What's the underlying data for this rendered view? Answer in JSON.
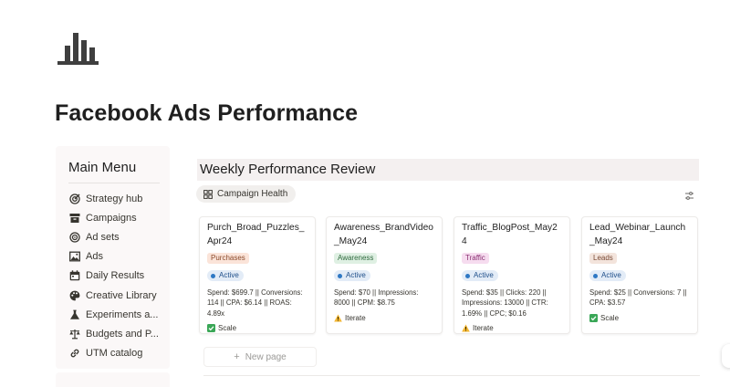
{
  "page": {
    "title": "Facebook Ads Performance",
    "icon": "bar-chart-icon"
  },
  "sidebar": {
    "heading": "Main Menu",
    "items": [
      {
        "label": "Strategy hub",
        "icon": "target-icon"
      },
      {
        "label": "Campaigns",
        "icon": "archive-box-icon"
      },
      {
        "label": "Ad sets",
        "icon": "concentric-circle-icon"
      },
      {
        "label": "Ads",
        "icon": "image-icon"
      },
      {
        "label": "Daily Results",
        "icon": "calendar-icon"
      },
      {
        "label": "Creative Library",
        "icon": "palette-icon"
      },
      {
        "label": "Experiments a...",
        "icon": "flask-icon"
      },
      {
        "label": "Budgets and P...",
        "icon": "scale-icon"
      },
      {
        "label": "UTM catalog",
        "icon": "link-icon"
      }
    ]
  },
  "database": {
    "title": "Weekly Performance Review",
    "view_tab": {
      "label": "Campaign Health",
      "icon": "grid-icon"
    },
    "settings_icon": "sliders-icon",
    "new_page_label": "New page"
  },
  "cards": [
    {
      "title": "Purch_Broad_Puzzles_Apr24",
      "tag": "Purchases",
      "tag_bg": "#fbe4d9",
      "tag_color": "#8a4a2b",
      "status": "Active",
      "metrics": "Spend: $699.7 || Conversions: 114 || CPA: $6.14 || ROAS: 4.89x",
      "action": "Scale",
      "action_icon": "check-box-icon"
    },
    {
      "title": "Awareness_BrandVideo_May24",
      "tag": "Awareness",
      "tag_bg": "#dff0e3",
      "tag_color": "#2f6a3e",
      "status": "Active",
      "metrics": "Spend: $70 || Impressions: 8000 || CPM: $8.75",
      "action": "Iterate",
      "action_icon": "warning-icon"
    },
    {
      "title": "Traffic_BlogPost_May24",
      "tag": "Traffic",
      "tag_bg": "#f6dcef",
      "tag_color": "#8a2f72",
      "status": "Active",
      "metrics": "Spend: $35 || Clicks: 220 || Impressions: 13000 || CTR: 1.69% || CPC; $0.16",
      "action": "Iterate",
      "action_icon": "warning-icon"
    },
    {
      "title": "Lead_Webinar_Launch_May24",
      "tag": "Leads",
      "tag_bg": "#f3e4dc",
      "tag_color": "#7a4a35",
      "status": "Active",
      "metrics": "Spend: $25 || Conversions: 7 || CPA: $3.57",
      "action": "Scale",
      "action_icon": "check-box-icon"
    }
  ]
}
